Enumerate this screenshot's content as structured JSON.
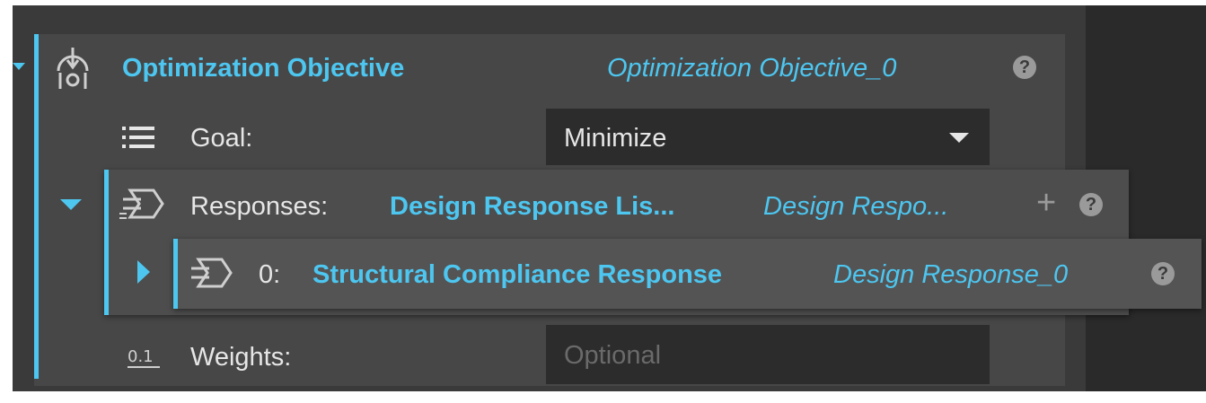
{
  "objective": {
    "title": "Optimization Objective",
    "instance": "Optimization Objective_0",
    "help": "?",
    "icon": "objective-icon"
  },
  "goal": {
    "label": "Goal:",
    "value": "Minimize",
    "icon": "list-icon"
  },
  "responses": {
    "label": "Responses:",
    "type": "Design Response Lis...",
    "instance": "Design Respo...",
    "add": "+",
    "help": "?",
    "icon": "response-list-icon",
    "items": [
      {
        "index": "0:",
        "name": "Structural Compliance Response",
        "instance": "Design Response_0",
        "help": "?",
        "icon": "response-icon"
      }
    ]
  },
  "weights": {
    "label": "Weights:",
    "placeholder": "Optional",
    "icon": "weights-icon",
    "icon_text": "0.1"
  },
  "colors": {
    "accent": "#4dc6f0",
    "panel": "#474747",
    "field": "#2c2c2c"
  }
}
